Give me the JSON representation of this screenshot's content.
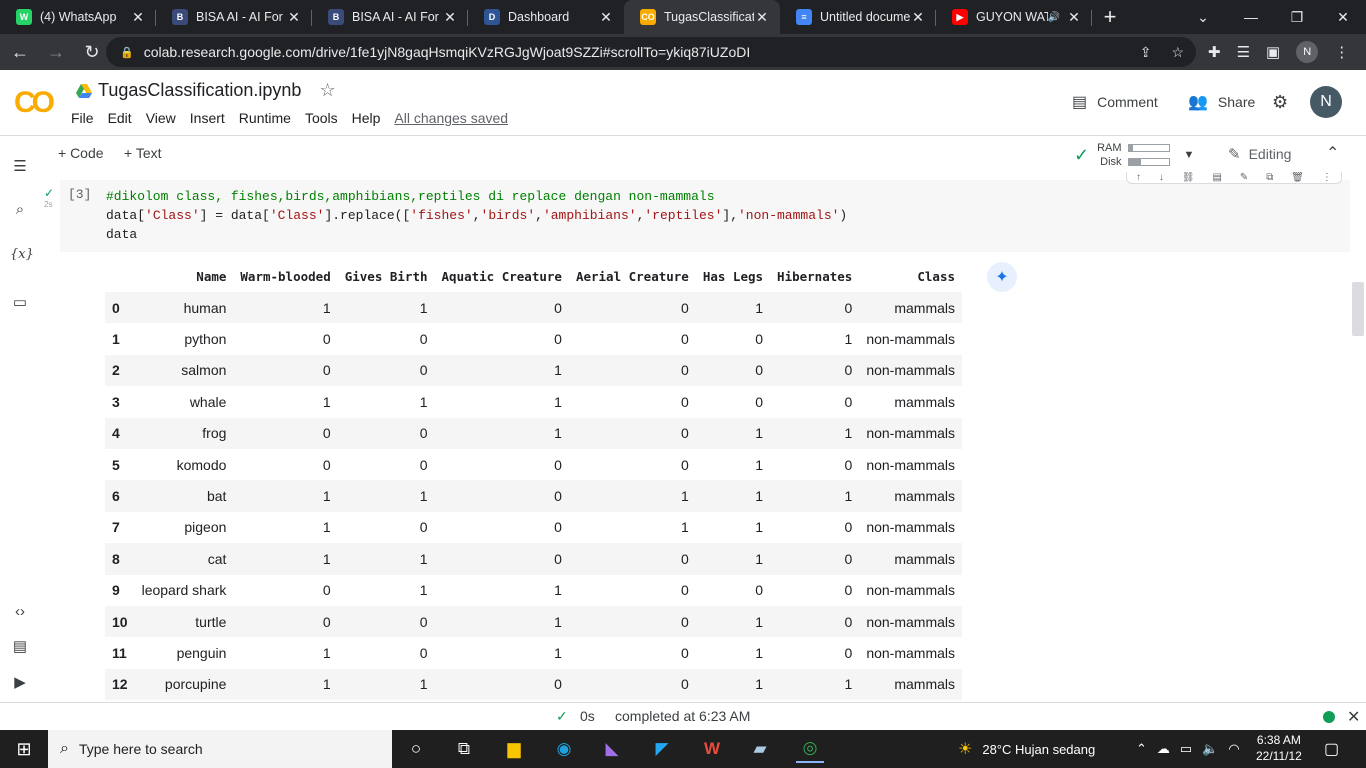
{
  "browser": {
    "tabs": [
      {
        "title": "(4) WhatsApp",
        "fav_color": "#25d366",
        "fav_text": "W"
      },
      {
        "title": "BISA AI - AI For E",
        "fav_color": "#3a4a7a",
        "fav_text": "B"
      },
      {
        "title": "BISA AI - AI For E",
        "fav_color": "#3a4a7a",
        "fav_text": "B"
      },
      {
        "title": "Dashboard",
        "fav_color": "#2f5597",
        "fav_text": "D"
      },
      {
        "title": "TugasClassificatio",
        "fav_color": "#f9ab00",
        "fav_text": "CO"
      },
      {
        "title": "Untitled docume",
        "fav_color": "#4285f4",
        "fav_text": "≡"
      },
      {
        "title": "GUYON WAT",
        "fav_color": "#ff0000",
        "fav_text": "▶"
      }
    ],
    "url": "colab.research.google.com/drive/1fe1yjN8gaqHsmqiKVzRGJgWjoat9SZZi#scrollTo=ykiq87iUZoDI",
    "profile_letter": "N"
  },
  "colab": {
    "logo": "CO",
    "notebook_title": "TugasClassification.ipynb",
    "menu": [
      "File",
      "Edit",
      "View",
      "Insert",
      "Runtime",
      "Tools",
      "Help"
    ],
    "save_status": "All changes saved",
    "comment_label": "Comment",
    "share_label": "Share",
    "avatar_letter": "N"
  },
  "toolbar": {
    "code_label": "+ Code",
    "text_label": "+ Text",
    "ram_label": "RAM",
    "disk_label": "Disk",
    "ram_fraction": 0.12,
    "disk_fraction": 0.3,
    "editing_label": "Editing"
  },
  "cell": {
    "execution_count": "[3]",
    "run_time": "2s",
    "code_lines": [
      {
        "comment": "#dikolom class, fishes,birds,amphibians,reptiles di replace dengan non-mammals"
      },
      {
        "prefix": "data[",
        "s1": "'Class'",
        "mid1": "] = data[",
        "s2": "'Class'",
        "mid2": "].replace([",
        "s3": "'fishes'",
        "c1": ",",
        "s4": "'birds'",
        "c2": ",",
        "s5": "'amphibians'",
        "c3": ",",
        "s6": "'reptiles'",
        "mid3": "],",
        "s7": "'non-mammals'",
        "end": ")"
      },
      {
        "plain": "data"
      }
    ]
  },
  "output": {
    "columns": [
      "",
      "Name",
      "Warm-blooded",
      "Gives Birth",
      "Aquatic Creature",
      "Aerial Creature",
      "Has Legs",
      "Hibernates",
      "Class"
    ],
    "rows": [
      [
        "0",
        "human",
        "1",
        "1",
        "0",
        "0",
        "1",
        "0",
        "mammals"
      ],
      [
        "1",
        "python",
        "0",
        "0",
        "0",
        "0",
        "0",
        "1",
        "non-mammals"
      ],
      [
        "2",
        "salmon",
        "0",
        "0",
        "1",
        "0",
        "0",
        "0",
        "non-mammals"
      ],
      [
        "3",
        "whale",
        "1",
        "1",
        "1",
        "0",
        "0",
        "0",
        "mammals"
      ],
      [
        "4",
        "frog",
        "0",
        "0",
        "1",
        "0",
        "1",
        "1",
        "non-mammals"
      ],
      [
        "5",
        "komodo",
        "0",
        "0",
        "0",
        "0",
        "1",
        "0",
        "non-mammals"
      ],
      [
        "6",
        "bat",
        "1",
        "1",
        "0",
        "1",
        "1",
        "1",
        "mammals"
      ],
      [
        "7",
        "pigeon",
        "1",
        "0",
        "0",
        "1",
        "1",
        "0",
        "non-mammals"
      ],
      [
        "8",
        "cat",
        "1",
        "1",
        "0",
        "0",
        "1",
        "0",
        "mammals"
      ],
      [
        "9",
        "leopard shark",
        "0",
        "1",
        "1",
        "0",
        "0",
        "0",
        "non-mammals"
      ],
      [
        "10",
        "turtle",
        "0",
        "0",
        "1",
        "0",
        "1",
        "0",
        "non-mammals"
      ],
      [
        "11",
        "penguin",
        "1",
        "0",
        "1",
        "0",
        "1",
        "0",
        "non-mammals"
      ],
      [
        "12",
        "porcupine",
        "1",
        "1",
        "0",
        "0",
        "1",
        "1",
        "mammals"
      ]
    ]
  },
  "status": {
    "duration": "0s",
    "completed": "completed at 6:23 AM"
  },
  "taskbar": {
    "search_placeholder": "Type here to search",
    "weather": "28°C  Hujan sedang",
    "time": "6:38 AM",
    "date": "22/11/12"
  }
}
